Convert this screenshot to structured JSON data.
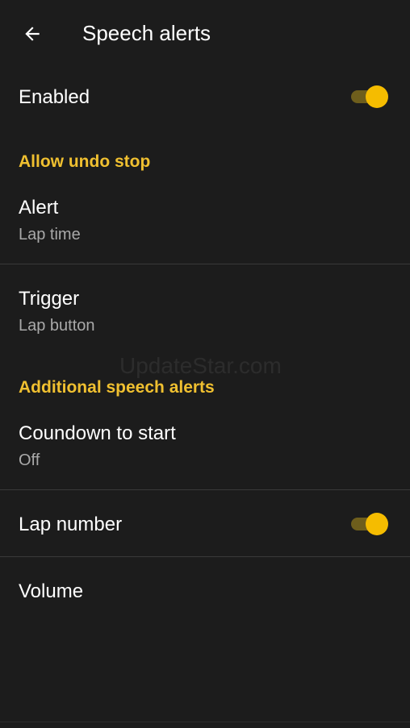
{
  "header": {
    "title": "Speech alerts",
    "back_icon": "arrow-left-icon"
  },
  "settings": {
    "enabled": {
      "label": "Enabled",
      "on": true
    },
    "section_1": "Allow undo stop",
    "alert": {
      "label": "Alert",
      "value": "Lap time"
    },
    "trigger": {
      "label": "Trigger",
      "value": "Lap button"
    },
    "section_2": "Additional speech alerts",
    "countdown": {
      "label": "Coundown to start",
      "value": "Off"
    },
    "lap_number": {
      "label": "Lap number",
      "on": true
    },
    "volume": {
      "label": "Volume"
    }
  },
  "watermark": "UpdateStar.com",
  "colors": {
    "accent": "#f5bc00",
    "section_header": "#f0c030",
    "background": "#1c1c1c",
    "secondary_text": "#a9a9a9",
    "switch_track": "#6e5e1c"
  }
}
